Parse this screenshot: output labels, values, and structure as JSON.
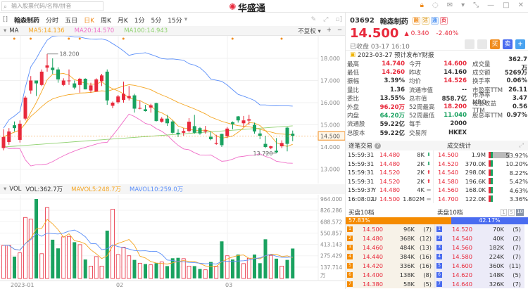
{
  "topbar": {
    "search_placeholder": "输入股票代码/名称/拼音",
    "logo_text": "华盛通"
  },
  "toolbar": {
    "stock_name": "翰森制药",
    "tabs": [
      "分时",
      "五日",
      "日K",
      "周K",
      "月K",
      "1分",
      "5分",
      "15分"
    ],
    "active_tab": "日K"
  },
  "ma_legend": {
    "label": "MA",
    "ma5": "MA5:14.136",
    "ma20": "MA20:14.570",
    "ma100": "MA100:14.943",
    "adjust": "不复权"
  },
  "colors": {
    "up": "#e8293b",
    "down": "#1aa260",
    "ma5": "#f5a623",
    "ma20": "#f06ec8",
    "ma100": "#8fd16f",
    "upper": "#5b8ff9",
    "accent": "#f08c1e"
  },
  "chart_data": {
    "type": "candlestick",
    "ylim": [
      12.5,
      18.8
    ],
    "yticks": [
      "18.000",
      "17.000",
      "16.000",
      "15.000",
      "14.000",
      "13.000"
    ],
    "current_price_label": "14.500",
    "high_label": "18.200",
    "low_label": "13.720",
    "xlabels": [
      "2023-01",
      "02",
      "03"
    ],
    "ohlc": [
      [
        13.95,
        14.8,
        13.85,
        14.45
      ],
      [
        14.22,
        14.85,
        14.1,
        14.7
      ],
      [
        14.98,
        15.15,
        14.7,
        14.85
      ],
      [
        14.32,
        15.2,
        14.2,
        15.05
      ],
      [
        15.28,
        16.3,
        15.2,
        16.23
      ],
      [
        16.55,
        17.2,
        16.4,
        17.0
      ],
      [
        17.0,
        17.0,
        16.3,
        16.87
      ],
      [
        16.8,
        17.5,
        16.75,
        17.4
      ],
      [
        17.58,
        18.2,
        17.4,
        17.68
      ],
      [
        17.58,
        18.0,
        17.3,
        17.47
      ],
      [
        17.5,
        17.6,
        16.9,
        17.05
      ],
      [
        16.8,
        17.1,
        16.75,
        17.0
      ],
      [
        16.98,
        17.5,
        16.8,
        17.0
      ],
      [
        16.87,
        17.0,
        16.6,
        16.68
      ],
      [
        16.8,
        17.12,
        16.45,
        17.08
      ],
      [
        17.08,
        17.1,
        16.6,
        16.6
      ],
      [
        16.55,
        16.9,
        16.45,
        16.78
      ],
      [
        16.5,
        17.1,
        16.5,
        17.05
      ],
      [
        16.97,
        17.3,
        16.75,
        17.23
      ],
      [
        17.4,
        17.5,
        15.9,
        16.1
      ],
      [
        15.86,
        16.05,
        15.75,
        16.0
      ],
      [
        16.02,
        16.35,
        15.95,
        16.28
      ],
      [
        16.12,
        16.95,
        16.0,
        16.4
      ],
      [
        16.2,
        16.75,
        16.1,
        16.3
      ],
      [
        16.33,
        16.4,
        15.55,
        15.73
      ],
      [
        15.75,
        16.1,
        15.7,
        15.76
      ],
      [
        15.7,
        15.9,
        15.6,
        15.62
      ],
      [
        15.78,
        15.95,
        15.55,
        15.88
      ],
      [
        15.98,
        16.0,
        15.15,
        15.17
      ],
      [
        15.14,
        15.35,
        15.1,
        15.28
      ],
      [
        15.28,
        15.45,
        14.95,
        15.07
      ],
      [
        15.15,
        15.2,
        14.6,
        14.64
      ],
      [
        14.64,
        14.8,
        14.45,
        14.57
      ],
      [
        14.64,
        14.85,
        14.5,
        14.72
      ],
      [
        14.72,
        15.3,
        14.65,
        15.14
      ],
      [
        14.94,
        15.45,
        14.6,
        14.64
      ],
      [
        14.85,
        14.9,
        14.55,
        14.61
      ],
      [
        14.7,
        14.95,
        14.6,
        14.75
      ],
      [
        14.46,
        14.7,
        14.3,
        14.35
      ],
      [
        14.14,
        14.55,
        14.1,
        14.18
      ],
      [
        14.59,
        14.6,
        14.0,
        14.08
      ],
      [
        14.48,
        14.9,
        14.4,
        14.83
      ],
      [
        15.12,
        15.15,
        14.8,
        15.03
      ],
      [
        15.38,
        15.4,
        15.1,
        15.2
      ],
      [
        15.07,
        15.4,
        14.9,
        15.2
      ],
      [
        15.19,
        15.45,
        15.0,
        15.25
      ],
      [
        15.0,
        15.1,
        14.6,
        14.7
      ],
      [
        14.61,
        14.8,
        14.35,
        14.5
      ],
      [
        14.14,
        14.5,
        13.95,
        14.0
      ],
      [
        13.95,
        14.05,
        13.9,
        14.03
      ],
      [
        13.83,
        14.4,
        13.72,
        13.76
      ],
      [
        14.03,
        14.3,
        13.95,
        14.18
      ],
      [
        14.87,
        14.9,
        13.8,
        14.14
      ],
      [
        14.6,
        14.74,
        14.26,
        14.5
      ]
    ],
    "volume_wan": [
      400,
      400,
      265,
      310,
      740,
      720,
      964,
      300,
      860,
      470,
      365,
      505,
      510,
      440,
      410,
      230,
      150,
      265,
      150,
      580,
      840,
      290,
      380,
      275,
      225,
      185,
      175,
      165,
      185,
      200,
      150,
      245,
      250,
      240,
      150,
      150,
      115,
      105,
      200,
      150,
      450,
      275,
      230,
      290,
      180,
      245,
      290,
      185,
      475,
      280,
      240,
      150,
      225,
      363
    ],
    "vol_ylim": [
      0,
      964
    ],
    "vol_yticks": [
      "964.000",
      "826.286",
      "688.572",
      "550.857",
      "413.143",
      "275.429",
      "137.714",
      "万"
    ]
  },
  "vol_legend": {
    "label": "VOL",
    "vol": "VOL:362.7万",
    "mavol5": "MAVOL5:248.7万",
    "mavol10": "MAVOL10:259.0万"
  },
  "quote": {
    "code": "03692",
    "name": "翰森制药",
    "badges": [
      "融",
      "沽",
      "通",
      "页"
    ],
    "price": "14.500",
    "change": "0.340",
    "change_pct": "-2.40%",
    "status": "已收盘 03-17 16:10",
    "buy_label": "买",
    "sell_label": "卖",
    "add_label": "+",
    "notice": "2023-03-27 预计发布Y财报"
  },
  "stats": [
    [
      "最高",
      "14.740",
      "今开",
      "14.600",
      "成交量",
      "362.7万"
    ],
    [
      "最低",
      "14.260",
      "昨收",
      "14.160",
      "成交额",
      "5269万"
    ],
    [
      "振幅",
      "3.39%",
      "均价",
      "14.526",
      "换手率",
      "0.06%"
    ],
    [
      "量比",
      "1.36",
      "流通市值",
      "--",
      "市盈率TTM",
      "26.11"
    ],
    [
      "委比",
      "13.55%",
      "总市值",
      "858.7亿",
      "市净率MRQ",
      "3.47"
    ],
    [
      "外盘",
      "96.20万",
      "52周最高",
      "18.200",
      "每股收益TTM",
      "0.56"
    ],
    [
      "内盘",
      "64.20万",
      "52周最低",
      "11.040",
      "股息率TTM",
      "0.97%"
    ],
    [
      "流通股",
      "59.22亿",
      "每手",
      "2000",
      "",
      ""
    ],
    [
      "总股本",
      "59.22亿",
      "交易所",
      "HKEX",
      "",
      ""
    ]
  ],
  "trades": {
    "title": "逐笔交易",
    "stats_title": "成交统计",
    "rows": [
      [
        "15:59:31",
        "",
        "14.480",
        "8K",
        "down"
      ],
      [
        "15:59:31",
        "",
        "14.480",
        "2K",
        "down"
      ],
      [
        "15:59:31",
        "",
        "14.520",
        "2K",
        "up"
      ],
      [
        "15:59:31",
        "",
        "14.520",
        "2K",
        "up"
      ],
      [
        "15:59:37",
        "Y",
        "14.480",
        "4K",
        "flat"
      ],
      [
        "16:08:02",
        "U",
        "14.500",
        "1.802M",
        "flat"
      ]
    ],
    "dist": [
      [
        "14.500",
        "1.9M",
        "53.92%"
      ],
      [
        "14.520",
        "370.0K",
        "10.20%"
      ],
      [
        "14.540",
        "298.0K",
        "8.22%"
      ],
      [
        "14.580",
        "196.6K",
        "5.42%"
      ],
      [
        "14.560",
        "168.0K",
        "4.63%"
      ],
      [
        "14.700",
        "122.0K",
        "3.36%"
      ]
    ]
  },
  "book": {
    "bid_title": "买盘10档",
    "ask_title": "卖盘10档",
    "levels": [
      "1",
      "5",
      "10"
    ],
    "bid_pct": "57.83%",
    "ask_pct": "42.17%",
    "bid_ratio": 0.5783,
    "bids": [
      [
        "1",
        "14.500",
        "96K",
        "(7)"
      ],
      [
        "2",
        "14.480",
        "368K",
        "(12)"
      ],
      [
        "3",
        "14.460",
        "484K",
        "(13)"
      ],
      [
        "4",
        "14.440",
        "384K",
        "(16)"
      ],
      [
        "5",
        "14.420",
        "336K",
        "(16)"
      ],
      [
        "6",
        "14.400",
        "138K",
        "(8)"
      ],
      [
        "7",
        "14.380",
        "58K",
        "(5)"
      ]
    ],
    "asks": [
      [
        "1",
        "14.520",
        "70K",
        "(5)"
      ],
      [
        "2",
        "14.540",
        "40K",
        "(2)"
      ],
      [
        "3",
        "14.560",
        "182K",
        "(7)"
      ],
      [
        "4",
        "14.580",
        "224K",
        "(7)"
      ],
      [
        "5",
        "14.600",
        "360K",
        "(11)"
      ],
      [
        "6",
        "14.620",
        "148K",
        "(5)"
      ],
      [
        "7",
        "14.640",
        "326K",
        "(7)"
      ]
    ]
  }
}
